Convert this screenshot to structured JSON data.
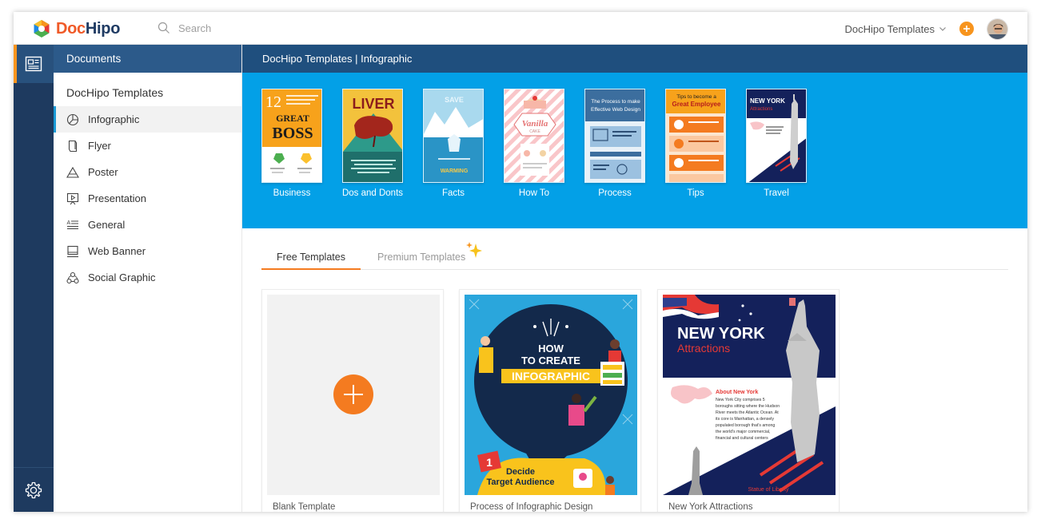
{
  "app": {
    "logo_doc": "Doc",
    "logo_hipo": "Hipo"
  },
  "search": {
    "placeholder": "Search"
  },
  "header": {
    "workspace": "DocHipo Templates"
  },
  "rail": {
    "items": [
      "documents-icon",
      "gear-icon"
    ]
  },
  "sidebar": {
    "header": "Documents",
    "section_title": "DocHipo Templates",
    "items": [
      {
        "label": "Infographic",
        "icon": "pie-chart-icon",
        "active": true
      },
      {
        "label": "Flyer",
        "icon": "flyer-icon"
      },
      {
        "label": "Poster",
        "icon": "triangle-icon"
      },
      {
        "label": "Presentation",
        "icon": "presentation-icon"
      },
      {
        "label": "General",
        "icon": "text-lines-icon"
      },
      {
        "label": "Web Banner",
        "icon": "monitor-icon"
      },
      {
        "label": "Social Graphic",
        "icon": "share-icon"
      }
    ]
  },
  "main": {
    "breadcrumb": "DocHipo Templates | Infographic",
    "categories": [
      {
        "label": "Business",
        "thumb_text": [
          "12",
          "GREAT",
          "BOSS"
        ]
      },
      {
        "label": "Dos and Donts",
        "thumb_text": [
          "LIVER"
        ]
      },
      {
        "label": "Facts",
        "thumb_text": [
          "SAVE",
          "WARMING"
        ]
      },
      {
        "label": "How To",
        "thumb_text": [
          "Vanilla",
          "CAKE"
        ]
      },
      {
        "label": "Process",
        "thumb_text": [
          "The Process to make",
          "Effective Web Design"
        ]
      },
      {
        "label": "Tips",
        "thumb_text": [
          "Tips to become a",
          "Great Employee"
        ]
      },
      {
        "label": "Travel",
        "thumb_text": [
          "NEW YORK",
          "Attractions"
        ]
      }
    ],
    "tabs": [
      {
        "label": "Free Templates",
        "active": true
      },
      {
        "label": "Premium Templates",
        "active": false
      }
    ],
    "cards": [
      {
        "title": "Blank Template"
      },
      {
        "title": "Process of Infographic Design",
        "art": {
          "line1": "HOW",
          "line2": "TO CREATE",
          "line3": "INFOGRAPHIC",
          "step_num": "1",
          "step_text1": "Decide",
          "step_text2": "Target Audience"
        }
      },
      {
        "title": "New York Attractions",
        "art": {
          "title": "NEW YORK",
          "subtitle": "Attractions",
          "section": "About New York",
          "body": [
            "New York City comprises 5",
            "boroughs sitting where the Hudson",
            "River meets the Atlantic Ocean. At",
            "its core is Manhattan, a densely",
            "populated borough that's among",
            "the world's major commercial,",
            "financial and cultural centers"
          ],
          "footer": "Statue of Liberty"
        }
      }
    ]
  },
  "colors": {
    "accent": "#f47b20",
    "hero": "#03a0e7",
    "navy": "#1e3a5f"
  }
}
